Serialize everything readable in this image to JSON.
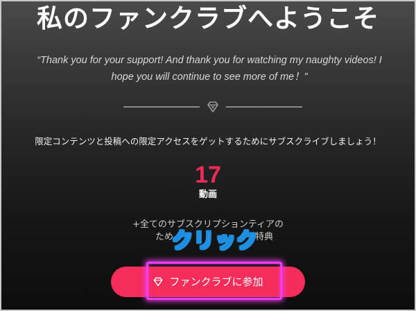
{
  "header": {
    "title": "私のファンクラブへようこそ"
  },
  "quote": {
    "line1": "“Thank you for your support! And thank you for watching my naughty videos! I",
    "line2": "hope you will continue to see more of me！”"
  },
  "icons": {
    "divider": "diamond-icon",
    "button": "diamond-icon"
  },
  "description": "限定コンテンツと投稿への限定アクセスをゲットするためにサブスクライブしましょう！",
  "stats": {
    "count": "17",
    "label": "動画"
  },
  "benefits": {
    "line1": "+全てのサブスクリプションティアの",
    "line2_left": "ため",
    "line2_right": "特典"
  },
  "annotation": {
    "callout": "クリック"
  },
  "join": {
    "button_label": "ファンクラブに参加"
  },
  "colors": {
    "accent": "#f52d5a",
    "count": "#ee2b57",
    "highlight": "#f03df0",
    "callout_stroke": "#1e8fe0"
  }
}
